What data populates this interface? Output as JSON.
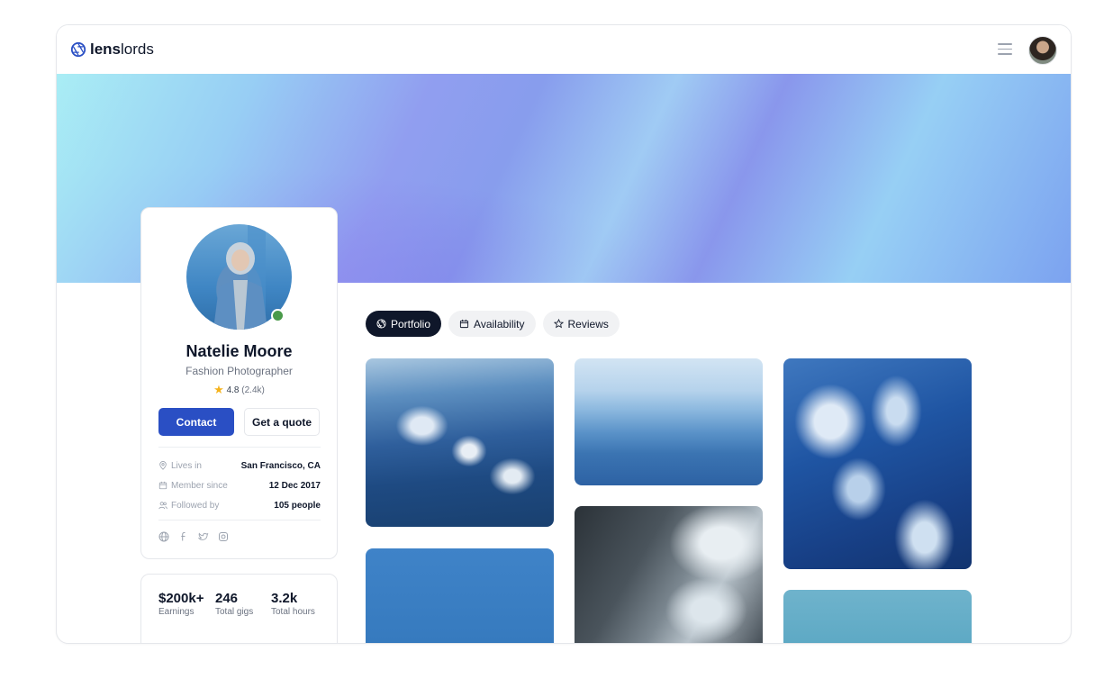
{
  "header": {
    "logo_bold": "lens",
    "logo_light": "lords"
  },
  "profile": {
    "name": "Natelie Moore",
    "title": "Fashion Photographer",
    "rating": "4.8",
    "rating_count": "(2.4k)",
    "contact_label": "Contact",
    "quote_label": "Get a quote",
    "info": [
      {
        "label": "Lives in",
        "value": "San Francisco, CA",
        "icon": "location-pin-icon"
      },
      {
        "label": "Member since",
        "value": "12 Dec 2017",
        "icon": "calendar-icon"
      },
      {
        "label": "Followed by",
        "value": "105 people",
        "icon": "users-icon"
      }
    ],
    "socials": [
      "globe-icon",
      "facebook-icon",
      "twitter-icon",
      "instagram-icon"
    ]
  },
  "stats": [
    {
      "value": "$200k+",
      "label": "Earnings"
    },
    {
      "value": "246",
      "label": "Total gigs"
    },
    {
      "value": "3.2k",
      "label": "Total hours"
    }
  ],
  "tabs": [
    {
      "label": "Portfolio",
      "icon": "aperture-icon",
      "active": true
    },
    {
      "label": "Availability",
      "icon": "calendar-icon",
      "active": false
    },
    {
      "label": "Reviews",
      "icon": "star-icon",
      "active": false
    }
  ],
  "colors": {
    "primary": "#2a4fc4",
    "dark": "#0f172a",
    "star": "#f5b21b",
    "online": "#4a9a4a"
  }
}
